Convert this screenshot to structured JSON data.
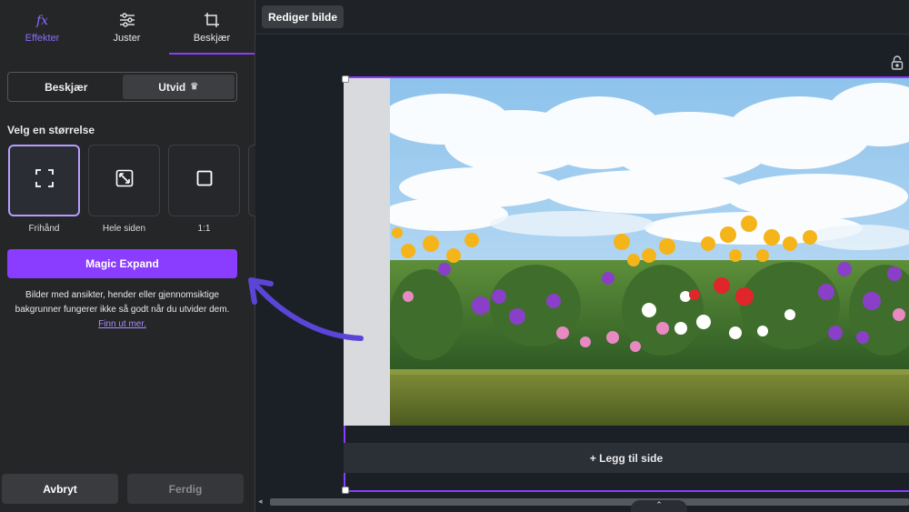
{
  "tabs": [
    {
      "label": "Effekter",
      "icon": "fx-icon"
    },
    {
      "label": "Juster",
      "icon": "sliders-icon"
    },
    {
      "label": "Beskjær",
      "icon": "crop-icon"
    }
  ],
  "segment": {
    "crop_label": "Beskjær",
    "expand_label": "Utvid",
    "expand_badge": "crown-icon"
  },
  "size_section": {
    "title": "Velg en størrelse",
    "options": [
      {
        "label": "Frihånd",
        "icon": "freeform-icon"
      },
      {
        "label": "Hele siden",
        "icon": "full-page-icon"
      },
      {
        "label": "1:1",
        "icon": "square-icon"
      }
    ]
  },
  "magic_expand": {
    "label": "Magic Expand"
  },
  "note": {
    "text": "Bilder med ansikter, hender eller gjennomsiktige bakgrunner fungerer ikke så godt når du utvider dem.",
    "link": "Finn ut mer."
  },
  "footer": {
    "cancel_label": "Avbryt",
    "done_label": "Ferdig"
  },
  "topbar": {
    "edit_label": "Rediger bilde"
  },
  "canvas": {
    "add_page_label": "+ Legg til side"
  },
  "colors": {
    "accent": "#8b3dff",
    "panel": "#252627",
    "canvas": "#1b1f26"
  }
}
